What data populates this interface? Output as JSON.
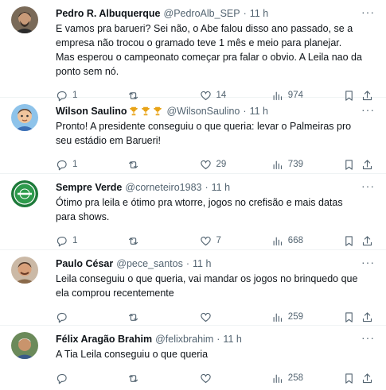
{
  "tweets": [
    {
      "name": "Pedro R. Albuquerque",
      "handle": "@PedroAlb_SEP",
      "time": "11 h",
      "text": "E vamos pra barueri? Sei não, o Abe falou disso ano passado, se a empresa não trocou o gramado teve 1 mês e meio para planejar. Mas esperou o campeonato começar pra falar o obvio. A Leila nao da ponto sem nó.",
      "replies": "1",
      "retweets": "",
      "likes": "14",
      "views": "974"
    },
    {
      "name": "Wilson Saulino",
      "handle": "@WilsonSaulino",
      "time": "11 h",
      "text": "Pronto! A presidente conseguiu o que queria: levar o Palmeiras pro seu estádio em Barueri!",
      "replies": "1",
      "retweets": "",
      "likes": "29",
      "views": "739"
    },
    {
      "name": "Sempre Verde",
      "handle": "@corneteiro1983",
      "time": "11 h",
      "text": "Ótimo pra leila e ótimo pra wtorre, jogos no crefisão e mais datas para shows.",
      "replies": "1",
      "retweets": "",
      "likes": "7",
      "views": "668"
    },
    {
      "name": "Paulo César",
      "handle": "@pece_santos",
      "time": "11 h",
      "text": "Leila conseguiu o que queria, vai mandar os jogos no brinquedo que ela comprou recentemente",
      "replies": "",
      "retweets": "",
      "likes": "",
      "views": "259"
    },
    {
      "name": "Félix Aragão Brahim",
      "handle": "@felixbrahim",
      "time": "11 h",
      "text": "A Tia Leila conseguiu o que queria",
      "replies": "",
      "retweets": "",
      "likes": "",
      "views": "258"
    }
  ],
  "separator": "·",
  "colors": {
    "text": "#0f1419",
    "secondary": "#536471",
    "border": "#eff3f4",
    "trophy": "#e8a317"
  },
  "icons": [
    "more-icon",
    "reply-icon",
    "retweet-icon",
    "like-icon",
    "views-icon",
    "bookmark-icon",
    "share-icon",
    "trophy-icon"
  ]
}
